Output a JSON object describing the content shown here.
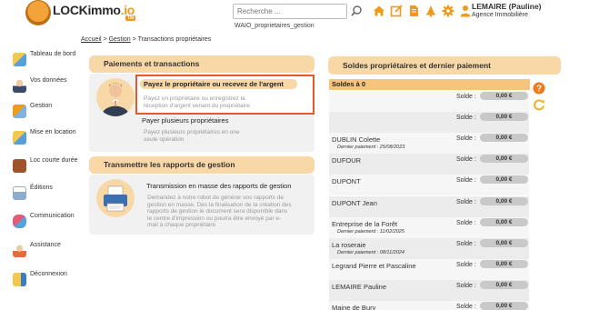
{
  "header": {
    "brand_main": "LOCKimmo",
    "brand_accent": ".io",
    "brand_badge": "TM",
    "search_placeholder": "Recherche ...",
    "page_code": "WAIO_proprietaires_gestion",
    "icons": [
      "home-icon",
      "edit-icon",
      "document-icon",
      "bell-icon",
      "gear-icon",
      "user-icon"
    ],
    "user_name": "LEMAIRE (Pauline)",
    "user_agency": "Agence Immobilière"
  },
  "breadcrumb": {
    "home": "Accueil",
    "sep1": ">",
    "section": "Gestion",
    "sep2": ">",
    "current": "Transactions propriétaires"
  },
  "sidebar": {
    "items": [
      {
        "label": "Tableau de bord",
        "icon": "dashboard-icon"
      },
      {
        "label": "Vos données",
        "icon": "person-icon"
      },
      {
        "label": "Gestion",
        "icon": "management-icon"
      },
      {
        "label": "Mise en location",
        "icon": "rental-icon"
      },
      {
        "label": "Loc courte durée",
        "icon": "suitcase-icon"
      },
      {
        "label": "Éditions",
        "icon": "printer-icon"
      },
      {
        "label": "Communication",
        "icon": "chat-icon"
      },
      {
        "label": "Assistance",
        "icon": "support-icon"
      },
      {
        "label": "Déconnexion",
        "icon": "logout-icon"
      }
    ]
  },
  "payments_panel": {
    "title": "Paiements et transactions",
    "actions": [
      {
        "title": "Payez le propriétaire ou recevez de l'argent",
        "desc_line1": "Payez un propriétaire ou enregistrez la",
        "desc_line2": "réception d'argent venant du propriétaire"
      },
      {
        "title": "Payer plusieurs propriétaires",
        "desc_line1": "Payez plusieurs propriétaires en une",
        "desc_line2": "seule opération"
      }
    ]
  },
  "reports_panel": {
    "title": "Transmettre les rapports de gestion",
    "action_title": "Transmission en masse des rapports de gestion",
    "desc_lines": [
      "Demandez à notre robot de générer vos rapports de",
      "gestion en masse. Dès la finalisation de la création des",
      "rapports de gestion le document sera disponible dans",
      "le centre d'impression ou pourra être envoyé par e-",
      "mail à chaque propriétaire"
    ]
  },
  "balances_panel": {
    "title": "Soldes propriétaires et dernier paiement",
    "subheader": "Soldes à 0",
    "solde_label": "Solde :",
    "last_payment_prefix": "Dernier paiement :",
    "rows": [
      {
        "name": "",
        "value": "0,00 €",
        "last_payment": ""
      },
      {
        "name": "",
        "value": "0,00 €",
        "last_payment": ""
      },
      {
        "name": "DUBLIN Colette",
        "value": "0,00 €",
        "last_payment": "25/08/2023"
      },
      {
        "name": "DUFOUR",
        "value": "0,00 €",
        "last_payment": ""
      },
      {
        "name": "DUPONT",
        "value": "0,00 €",
        "last_payment": ""
      },
      {
        "name": "DUPONT Jean",
        "value": "0,00 €",
        "last_payment": ""
      },
      {
        "name": "Entreprise de la Forêt",
        "value": "0,00 €",
        "last_payment": "11/02/2025"
      },
      {
        "name": "La roseraie",
        "value": "0,00 €",
        "last_payment": "08/11/2024"
      },
      {
        "name": "Legrand Pierre et Pascaline",
        "value": "0,00 €",
        "last_payment": ""
      },
      {
        "name": "LEMAIRE Pauline",
        "value": "0,00 €",
        "last_payment": ""
      },
      {
        "name": "Maine de Bury",
        "value": "0,00 €",
        "last_payment": ""
      }
    ]
  },
  "colors": {
    "accent_orange": "#f09a1a",
    "panel_header": "#f8d8a6",
    "highlight_border": "#e9582a"
  }
}
